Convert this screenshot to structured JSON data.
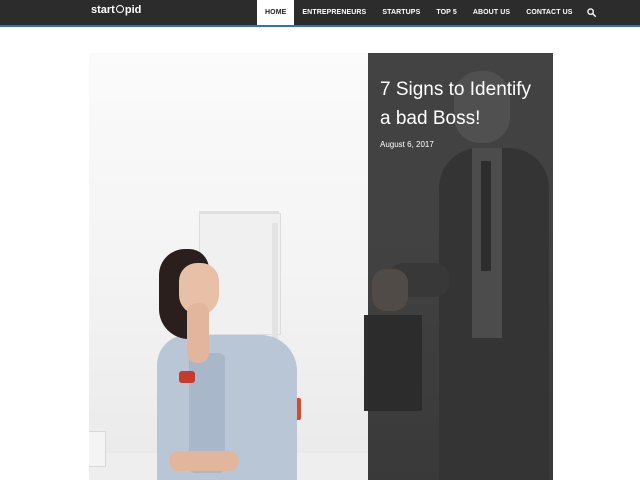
{
  "header": {
    "logo_text_start": "start",
    "logo_text_end": "pid",
    "nav": [
      {
        "label": "HOME",
        "active": true
      },
      {
        "label": "ENTREPRENEURS",
        "active": false
      },
      {
        "label": "STARTUPS",
        "active": false
      },
      {
        "label": "TOP 5",
        "active": false
      },
      {
        "label": "ABOUT US",
        "active": false
      },
      {
        "label": "CONTACT US",
        "active": false
      }
    ],
    "search_icon": "search-icon"
  },
  "featured": {
    "title": "7 Signs to Identify a bad Boss!",
    "date": "August 6, 2017"
  },
  "colors": {
    "header_bg": "#2c2c2c",
    "accent_border": "#2f6fd0",
    "overlay_panel": "#474747"
  }
}
